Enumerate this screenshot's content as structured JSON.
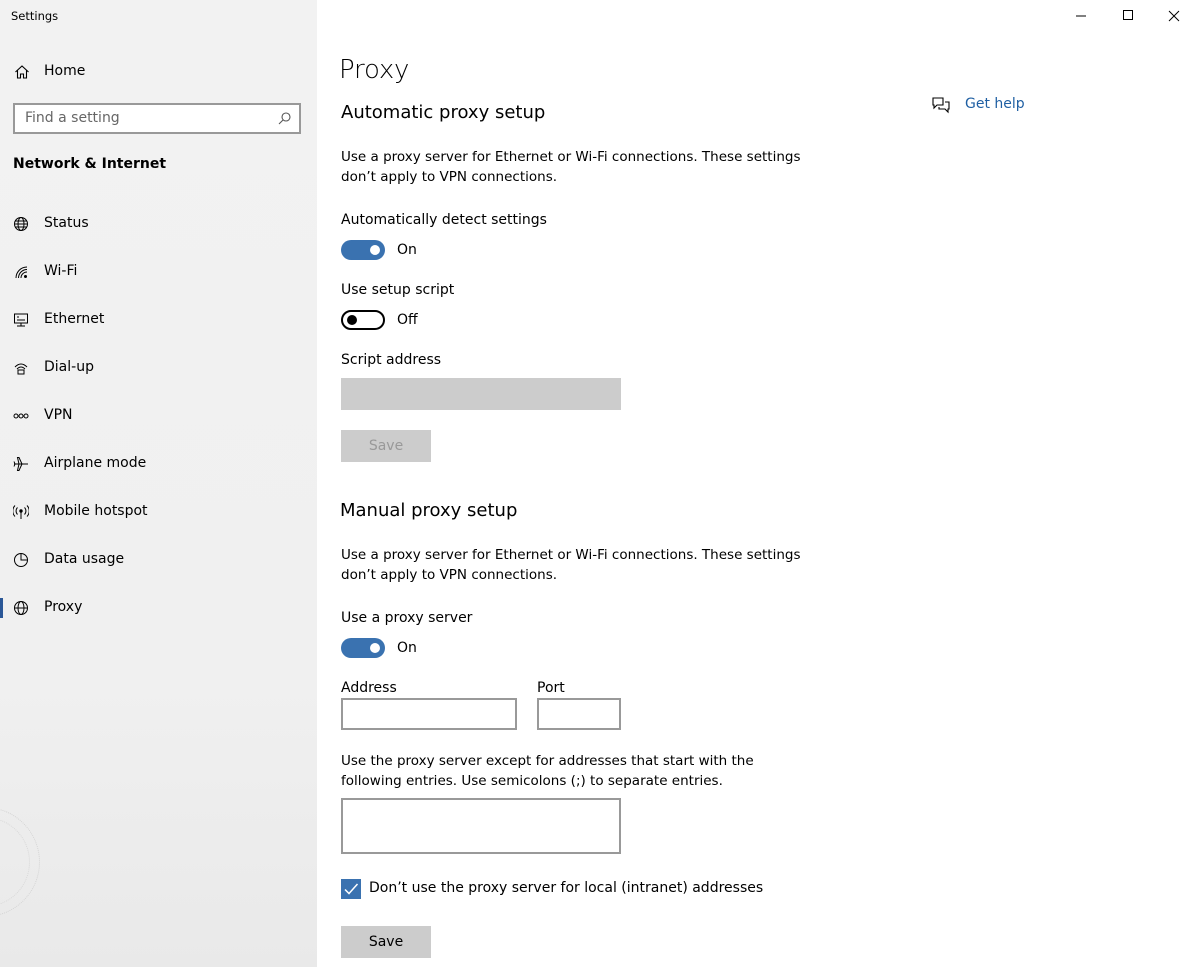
{
  "window": {
    "title": "Settings"
  },
  "sidebar": {
    "home_label": "Home",
    "search_placeholder": "Find a setting",
    "section_title": "Network & Internet",
    "items": [
      {
        "label": "Status",
        "icon": "globe-status-icon"
      },
      {
        "label": "Wi-Fi",
        "icon": "wifi-icon"
      },
      {
        "label": "Ethernet",
        "icon": "ethernet-icon"
      },
      {
        "label": "Dial-up",
        "icon": "dialup-icon"
      },
      {
        "label": "VPN",
        "icon": "vpn-icon"
      },
      {
        "label": "Airplane mode",
        "icon": "airplane-icon"
      },
      {
        "label": "Mobile hotspot",
        "icon": "hotspot-icon"
      },
      {
        "label": "Data usage",
        "icon": "data-usage-icon"
      },
      {
        "label": "Proxy",
        "icon": "globe-icon",
        "active": true
      }
    ]
  },
  "main": {
    "title": "Proxy",
    "get_help": "Get help",
    "automatic": {
      "heading": "Automatic proxy setup",
      "description": "Use a proxy server for Ethernet or Wi-Fi connections. These settings don’t apply to VPN connections.",
      "detect_label": "Automatically detect settings",
      "detect_state": "On",
      "script_label": "Use setup script",
      "script_state": "Off",
      "script_address_label": "Script address",
      "script_address_value": "",
      "save_label": "Save"
    },
    "manual": {
      "heading": "Manual proxy setup",
      "description": "Use a proxy server for Ethernet or Wi-Fi connections. These settings don’t apply to VPN connections.",
      "use_proxy_label": "Use a proxy server",
      "use_proxy_state": "On",
      "address_label": "Address",
      "address_value": "",
      "port_label": "Port",
      "port_value": "",
      "exceptions_description": "Use the proxy server except for addresses that start with the following entries. Use semicolons (;) to separate entries.",
      "exceptions_value": "",
      "local_checkbox_label": "Don’t use the proxy server for local (intranet) addresses",
      "local_checkbox_checked": true,
      "save_label": "Save"
    }
  },
  "colors": {
    "accent": "#3a72b0",
    "link": "#1f5fa3",
    "sidebar_bg": "#f2f2f2",
    "disabled": "#cccccc"
  }
}
